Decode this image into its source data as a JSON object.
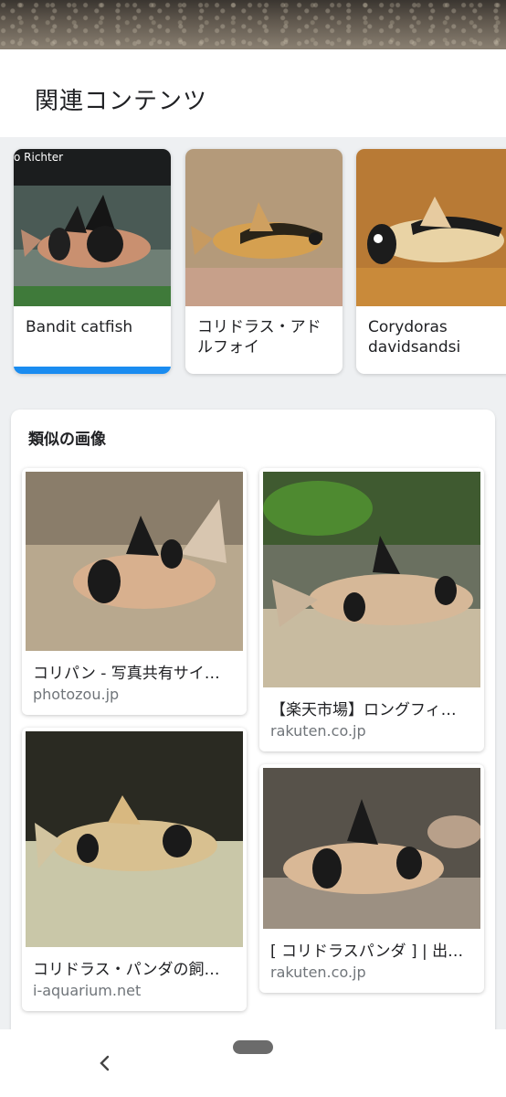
{
  "header": {
    "title": "関連コンテンツ"
  },
  "related": [
    {
      "label": "Bandit catfish",
      "credit": "o Richter",
      "active": true
    },
    {
      "label": "コリドラス・アドルフォイ",
      "active": false
    },
    {
      "label": "Corydoras davidsandsi",
      "active": false
    }
  ],
  "similar": {
    "title": "類似の画像",
    "items": [
      {
        "title": "コリパン - 写真共有サイ…",
        "domain": "photozou.jp"
      },
      {
        "title": "【楽天市場】ロングフィ…",
        "domain": "rakuten.co.jp"
      },
      {
        "title": "コリドラス・パンダの飼…",
        "domain": "i-aquarium.net"
      },
      {
        "title": "[ コリドラスパンダ ] | 出…",
        "domain": "rakuten.co.jp"
      }
    ]
  },
  "nav": {
    "back_icon": "chevron-left-icon",
    "home_icon": "home-pill-icon"
  },
  "colors": {
    "accent": "#1a8cf0",
    "domain_text": "#70757a"
  }
}
